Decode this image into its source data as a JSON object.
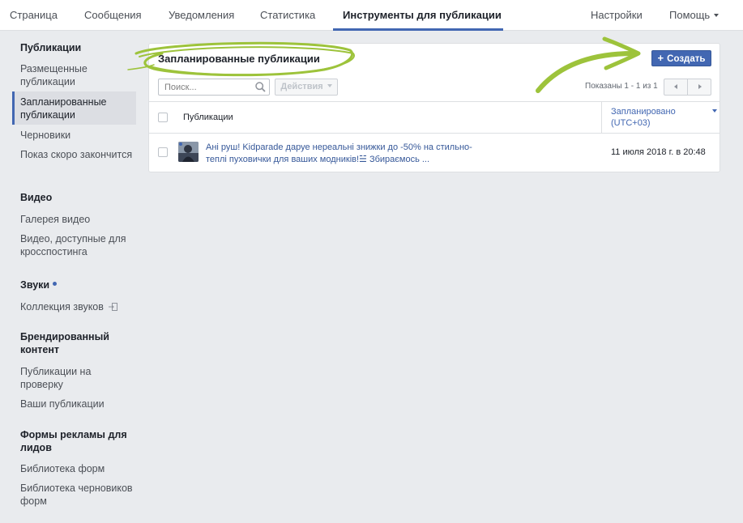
{
  "topnav": {
    "tabs": [
      {
        "label": "Страница"
      },
      {
        "label": "Сообщения"
      },
      {
        "label": "Уведомления"
      },
      {
        "label": "Статистика"
      },
      {
        "label": "Инструменты для публикации"
      }
    ],
    "settings": "Настройки",
    "help": "Помощь"
  },
  "sidebar": {
    "sections": [
      {
        "title": "Публикации",
        "items": [
          "Размещенные публикации",
          "Запланированные публикации",
          "Черновики",
          "Показ скоро закончится"
        ]
      },
      {
        "title": "Видео",
        "items": [
          "Галерея видео",
          "Видео, доступные для кросспостинга"
        ]
      },
      {
        "title": "Звуки",
        "items": [
          "Коллекция звуков"
        ]
      },
      {
        "title": "Брендированный контент",
        "items": [
          "Публикации на проверку",
          "Ваши публикации"
        ]
      },
      {
        "title": "Формы рекламы для лидов",
        "items": [
          "Библиотека форм",
          "Библиотека черновиков форм"
        ]
      }
    ]
  },
  "main": {
    "title": "Запланированные публикации",
    "create_button": "Создать",
    "search_placeholder": "Поиск...",
    "actions_button": "Действия",
    "pager_text": "Показаны 1 - 1 из 1",
    "columns": {
      "publications": "Публикации",
      "scheduled": "Запланировано (UTC+03)"
    },
    "rows": [
      {
        "text": "Ані руш! Kidparade даруе нереальні знижки до -50% на стильно-теплі пуховички для ваших модників!☱ Збираємось ...",
        "date": "11 июля 2018 г. в 20:48"
      }
    ]
  },
  "colors": {
    "accent": "#4267b2",
    "highlight": "#9dc33b",
    "background": "#e9ebee"
  },
  "icons": {
    "search": "search-icon",
    "plus": "plus-icon",
    "prev": "chevron-left-icon",
    "next": "chevron-right-icon",
    "external": "external-link-icon",
    "arrow": "arrow-annotation-icon"
  }
}
